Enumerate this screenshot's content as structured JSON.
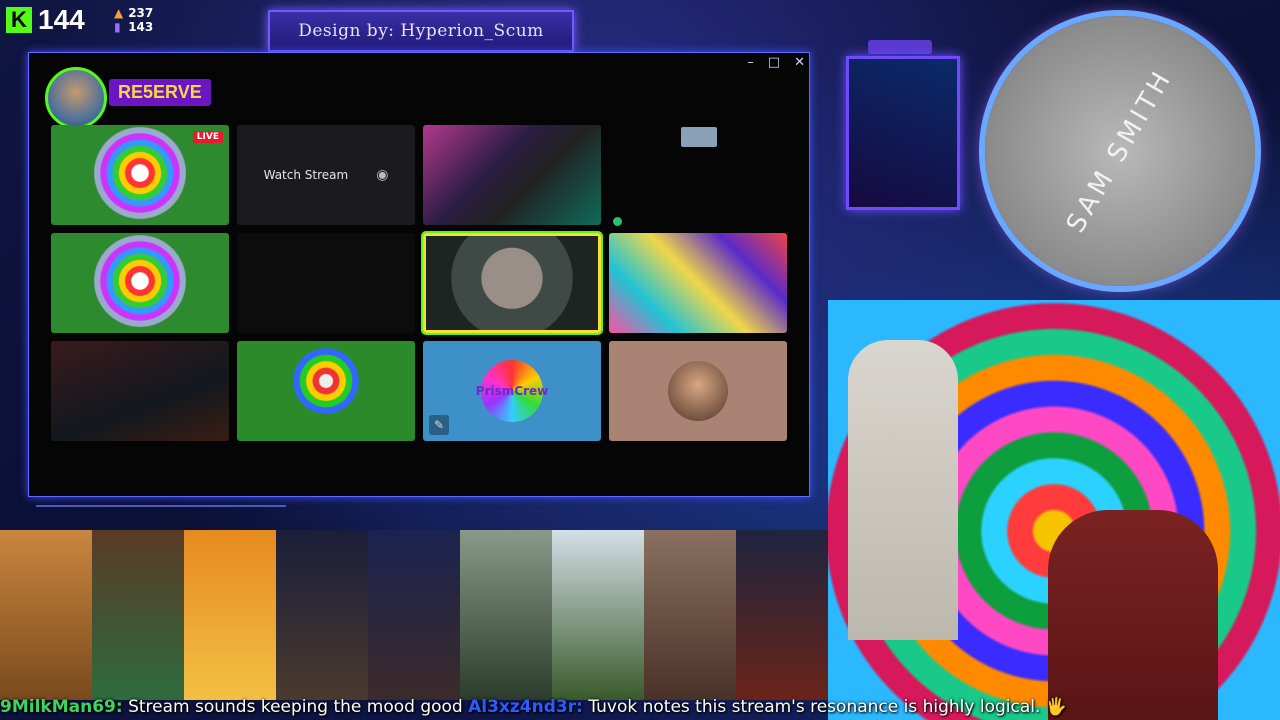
{
  "overlay": {
    "kick_count": "144",
    "followers": "237",
    "subs": "143",
    "banner_text": "Design by: Hyperion_Scum"
  },
  "window": {
    "channel_name": "RE5ERVE",
    "controls": [
      "–",
      "□",
      "✕"
    ],
    "tiles": {
      "live_badge": "LIVE",
      "watch_stream_label": "Watch Stream",
      "prism_logo_text": "PrismCrew"
    }
  },
  "album": {
    "text": "SAM SMITH"
  },
  "ticker": {
    "user1": "9MilkMan69:",
    "msg1": "Stream sounds keeping the mood good",
    "user2": "Al3xz4nd3r:",
    "msg2": "Tuvok notes this stream's resonance is highly logical. 🖐"
  },
  "colors": {
    "kick_green": "#53fc18",
    "accent_purple": "#6b16c2",
    "frame_blue": "#5f6bff"
  }
}
